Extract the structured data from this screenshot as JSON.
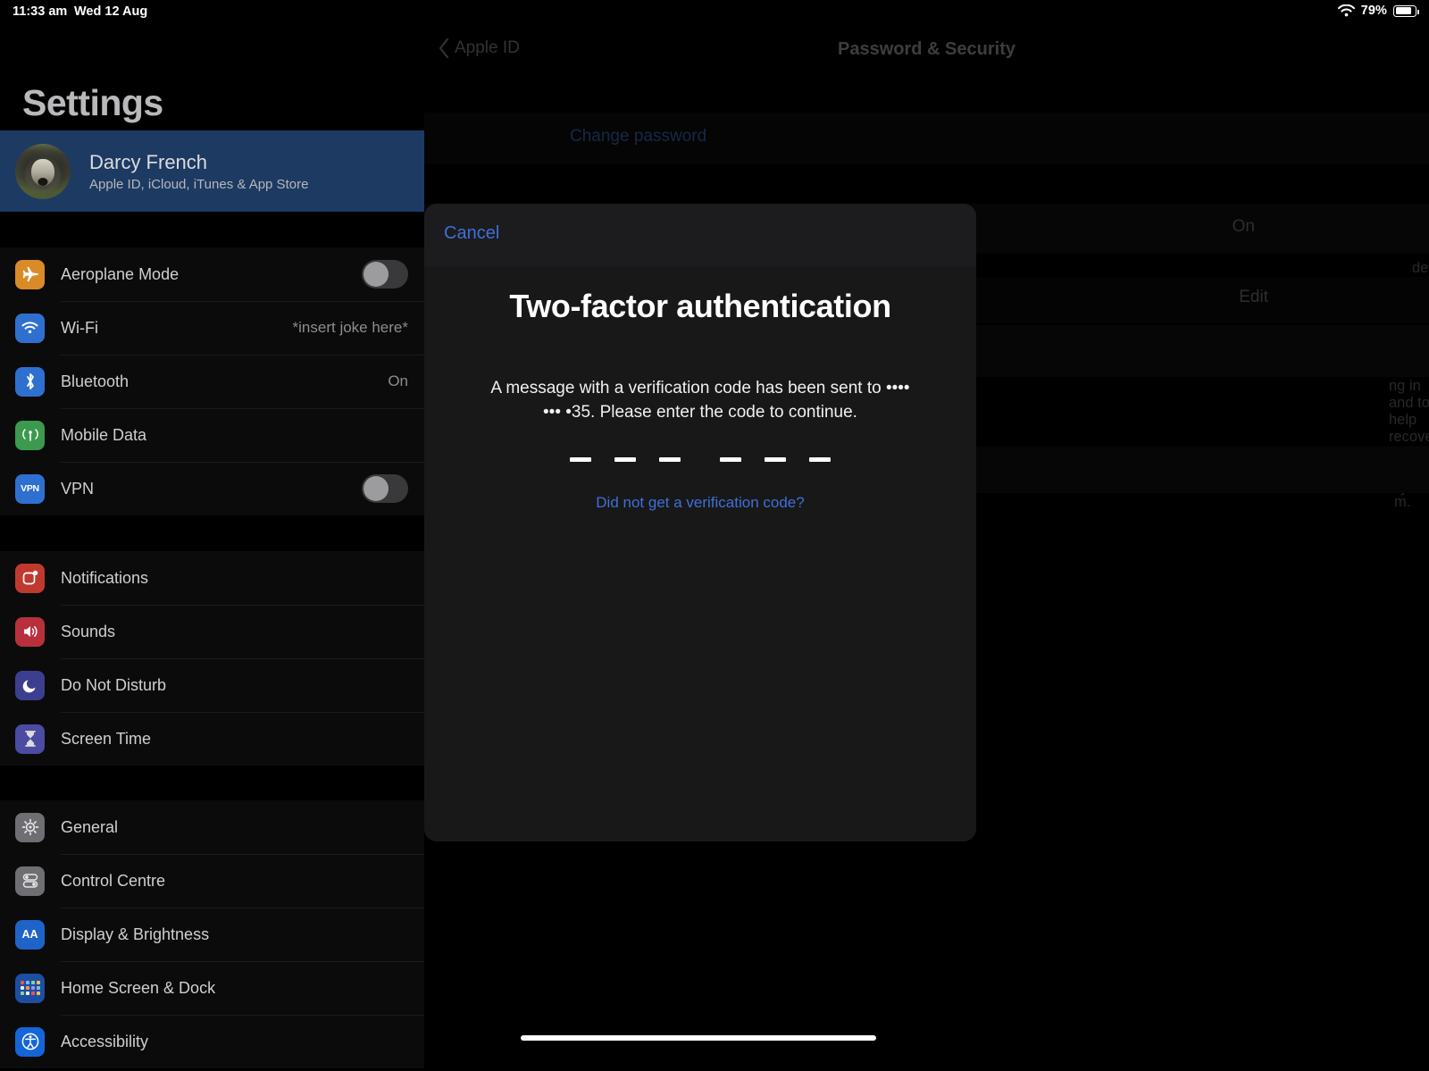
{
  "status_bar": {
    "time": "11:33 am",
    "date": "Wed 12 Aug",
    "battery_percent": "79%",
    "wifi_icon": "wifi-icon",
    "battery_icon": "battery-icon"
  },
  "sidebar": {
    "title": "Settings",
    "profile": {
      "name": "Darcy French",
      "subtitle": "Apple ID, iCloud, iTunes & App Store",
      "avatar_icon": "avatar-dog-photo"
    },
    "groups": [
      {
        "items": [
          {
            "label": "Aeroplane Mode",
            "icon": "aeroplane-icon",
            "icon_class": "ic-plane",
            "glyph": "✈",
            "control": "toggle",
            "toggle_on": false
          },
          {
            "label": "Wi-Fi",
            "icon": "wifi-icon",
            "icon_class": "ic-wifi",
            "glyph": "wifi",
            "control": "value",
            "value": "*insert joke here*"
          },
          {
            "label": "Bluetooth",
            "icon": "bluetooth-icon",
            "icon_class": "ic-bt",
            "glyph": "bt",
            "control": "value",
            "value": "On"
          },
          {
            "label": "Mobile Data",
            "icon": "mobile-data-icon",
            "icon_class": "ic-cell",
            "glyph": "cell",
            "control": "none",
            "value": ""
          },
          {
            "label": "VPN",
            "icon": "vpn-icon",
            "icon_class": "ic-vpn",
            "glyph": "VPN",
            "control": "toggle",
            "toggle_on": false
          }
        ]
      },
      {
        "items": [
          {
            "label": "Notifications",
            "icon": "notifications-icon",
            "icon_class": "ic-notif",
            "glyph": "notif",
            "control": "none",
            "value": ""
          },
          {
            "label": "Sounds",
            "icon": "sounds-icon",
            "icon_class": "ic-sound",
            "glyph": "🔊",
            "control": "none",
            "value": ""
          },
          {
            "label": "Do Not Disturb",
            "icon": "do-not-disturb-icon",
            "icon_class": "ic-dnd",
            "glyph": "☾",
            "control": "none",
            "value": ""
          },
          {
            "label": "Screen Time",
            "icon": "screen-time-icon",
            "icon_class": "ic-screen",
            "glyph": "⌛",
            "control": "none",
            "value": ""
          }
        ]
      },
      {
        "items": [
          {
            "label": "General",
            "icon": "gear-icon",
            "icon_class": "ic-gen",
            "glyph": "gear",
            "control": "none",
            "value": ""
          },
          {
            "label": "Control Centre",
            "icon": "control-centre-icon",
            "icon_class": "ic-cc",
            "glyph": "cc",
            "control": "none",
            "value": ""
          },
          {
            "label": "Display & Brightness",
            "icon": "display-brightness-icon",
            "icon_class": "ic-disp",
            "glyph": "AA",
            "control": "none",
            "value": ""
          },
          {
            "label": "Home Screen & Dock",
            "icon": "home-screen-dock-icon",
            "icon_class": "ic-home",
            "glyph": "grid",
            "control": "none",
            "value": ""
          },
          {
            "label": "Accessibility",
            "icon": "accessibility-icon",
            "icon_class": "ic-acc",
            "glyph": "acc",
            "control": "none",
            "value": ""
          }
        ]
      }
    ]
  },
  "pane": {
    "back_label": "Apple ID",
    "title": "Password & Security",
    "change_password_label": "Change password",
    "two_factor_value": "On",
    "two_factor_note": "dentity when signing in.",
    "edit_label": "Edit",
    "trusted_note": "ng in and to help recover your account if you",
    "tail_note": "m."
  },
  "modal": {
    "cancel_label": "Cancel",
    "title": "Two-factor authentication",
    "description": "A message with a verification code has been sent to •••• ••• •35. Please enter the code to continue.",
    "help_link": "Did not get a verification code?",
    "code_length": 6,
    "code_value": "",
    "code_groups": [
      3,
      3
    ]
  },
  "colors": {
    "accent_blue": "#3f6fd8",
    "profile_row_blue": "#1d3a63",
    "modal_bg": "#181818",
    "page_bg": "#000000"
  }
}
